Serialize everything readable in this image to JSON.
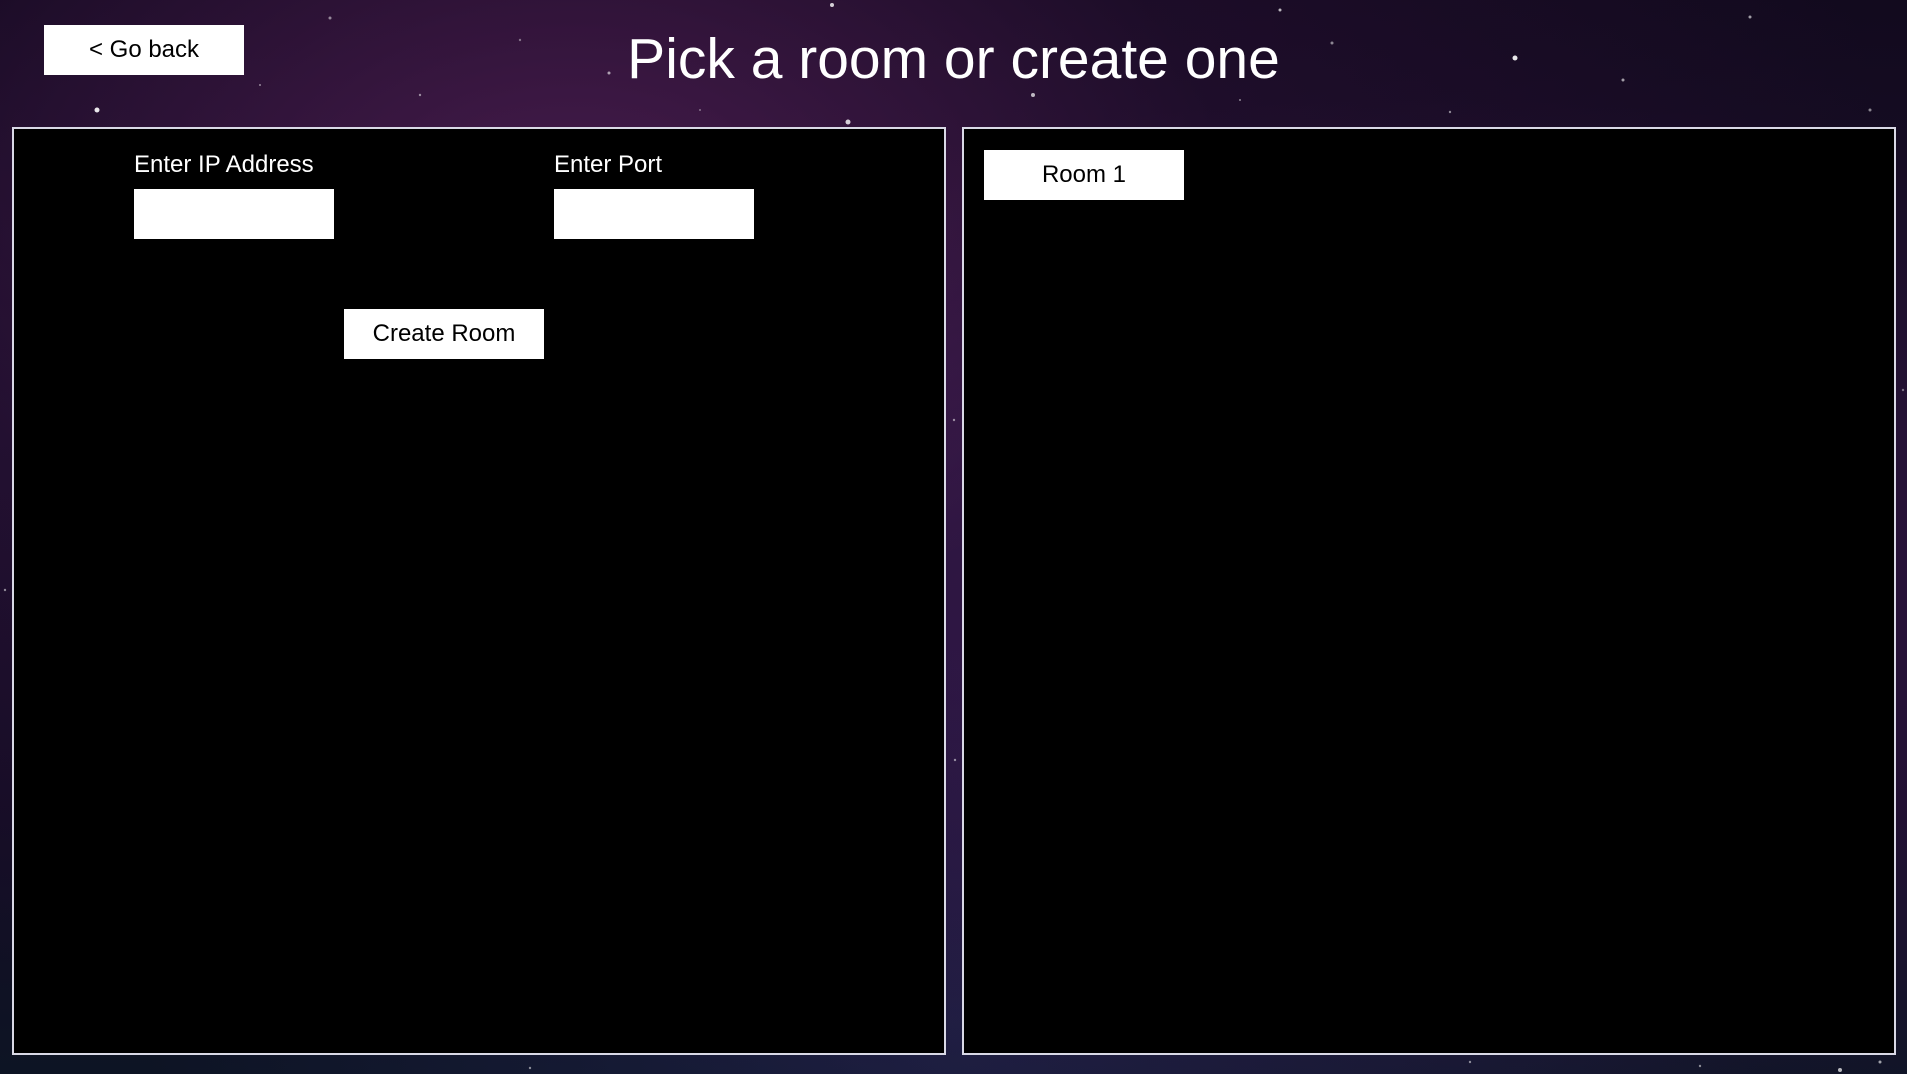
{
  "header": {
    "back_label": "< Go back",
    "title": "Pick a room or create one"
  },
  "create_panel": {
    "ip_label": "Enter IP Address",
    "ip_value": "",
    "port_label": "Enter Port",
    "port_value": "",
    "create_label": "Create Room"
  },
  "rooms_panel": {
    "rooms": [
      {
        "label": "Room 1"
      }
    ]
  },
  "colors": {
    "panel_background": "#000000",
    "panel_border": "#d9d9e6",
    "button_background": "#ffffff",
    "text": "#ffffff"
  }
}
